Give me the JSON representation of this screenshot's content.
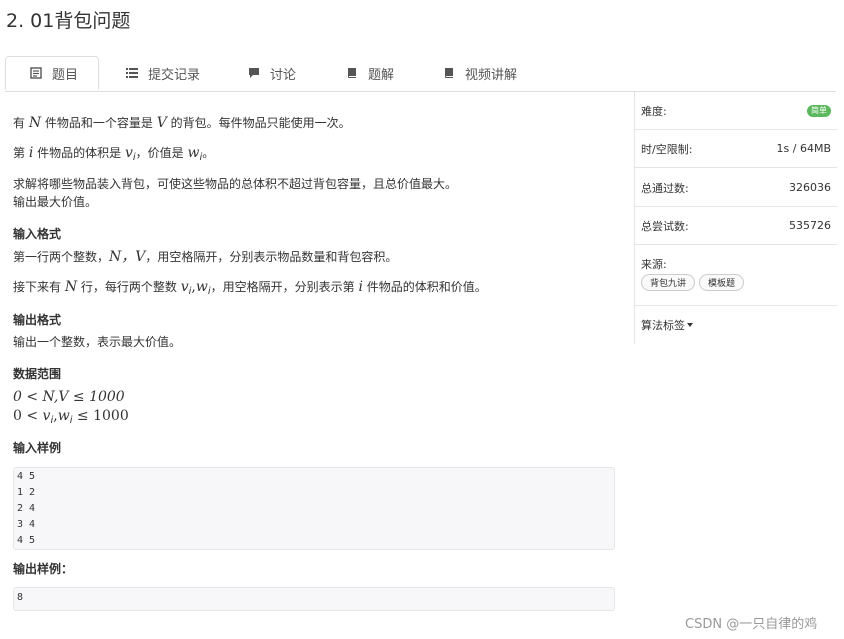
{
  "page": {
    "title": "2. 01背包问题"
  },
  "tabs": [
    {
      "label": "题目",
      "icon": "document-icon"
    },
    {
      "label": "提交记录",
      "icon": "list-icon"
    },
    {
      "label": "讨论",
      "icon": "comment-icon"
    },
    {
      "label": "题解",
      "icon": "book-icon"
    },
    {
      "label": "视频讲解",
      "icon": "book-icon"
    }
  ],
  "problem": {
    "p1": {
      "a": "有 ",
      "N": "N",
      "b": " 件物品和一个容量是 ",
      "V": "V",
      "c": " 的背包。每件物品只能使用一次。"
    },
    "p2": {
      "a": "第 ",
      "i": "i",
      "b": " 件物品的体积是 ",
      "v": "v",
      "vi": "i",
      "c": "，价值是 ",
      "w": "w",
      "wi": "i",
      "d": "。"
    },
    "p3": {
      "line1": "求解将哪些物品装入背包，可使这些物品的总体积不超过背包容量，且总价值最大。",
      "line2": "输出最大价值。"
    },
    "input_heading": "输入格式",
    "p4": {
      "a": "第一行两个整数，",
      "NV": "N，V",
      "b": "，用空格隔开，分别表示物品数量和背包容积。"
    },
    "p5": {
      "a": "接下来有 ",
      "N": "N",
      "b": " 行，每行两个整数 ",
      "v": "v",
      "vi": "i",
      "comma": ",",
      "w": "w",
      "wi": "i",
      "c": "，用空格隔开，分别表示第 ",
      "i": "i",
      "d": " 件物品的体积和价值。"
    },
    "output_heading": "输出格式",
    "p6": "输出一个整数，表示最大价值。",
    "range_heading": "数据范围",
    "range1": "0 < N,V ≤ 1000",
    "range2": {
      "a": "0 < ",
      "v": "v",
      "vi": "i",
      "comma": ",",
      "w": "w",
      "wi": "i",
      "b": " ≤ 1000"
    },
    "sample_in_heading": "输入样例",
    "sample_in": [
      "4 5",
      "1 2",
      "2 4",
      "3 4",
      "4 5"
    ],
    "sample_out_heading": "输出样例：",
    "sample_out": [
      "8"
    ]
  },
  "sidebar": {
    "difficulty_label": "难度:",
    "difficulty_badge": "简单",
    "limit_label": "时/空限制:",
    "limit_value": "1s / 64MB",
    "passed_label": "总通过数:",
    "passed_value": "326036",
    "attempts_label": "总尝试数:",
    "attempts_value": "535726",
    "source_label": "来源:",
    "source_chips": [
      "背包九讲",
      "模板题"
    ],
    "tags_label": "算法标签"
  },
  "watermark": "CSDN @一只自律的鸡",
  "colors": {
    "badge": "#5cb85c",
    "border": "#dddddd",
    "codebg": "#f7f7f9"
  }
}
